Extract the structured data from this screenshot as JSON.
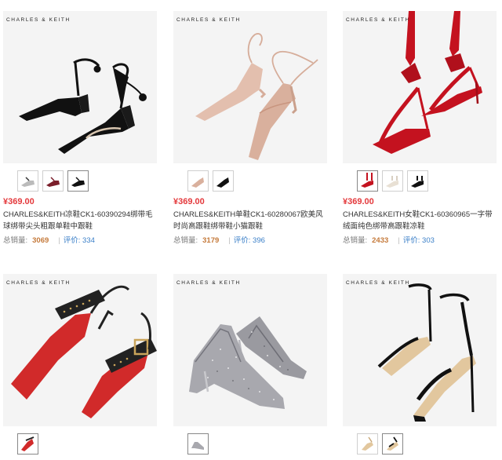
{
  "products": [
    {
      "brand": "CHARLES & KEITH",
      "price": "¥369.00",
      "title": "CHARLES&KEITH凉鞋CK1-60390294绑带毛球绑带尖头粗跟单鞋中跟鞋",
      "sales_label": "总销量:",
      "sales": "3069",
      "reviews_label": "评价:",
      "reviews": "334",
      "image_icon": "black-lace-up-pom-pom-pump-icon",
      "thumbs": [
        "white-variant",
        "burgundy-variant",
        "black-variant"
      ]
    },
    {
      "brand": "CHARLES & KEITH",
      "price": "¥369.00",
      "title": "CHARLES&KEITH单鞋CK1-60280067欧美风时尚高跟鞋绑带鞋小猫跟鞋",
      "sales_label": "总销量:",
      "sales": "3179",
      "reviews_label": "评价:",
      "reviews": "396",
      "image_icon": "nude-lace-up-kitten-heel-icon",
      "thumbs": [
        "nude-variant",
        "black-variant"
      ]
    },
    {
      "brand": "CHARLES & KEITH",
      "price": "¥369.00",
      "title": "CHARLES&KEITH女鞋CK1-60360965一字带绒面纯色绑带高跟鞋凉鞋",
      "sales_label": "总销量:",
      "sales": "2433",
      "reviews_label": "评价:",
      "reviews": "303",
      "image_icon": "red-ribbon-heel-sandal-icon",
      "thumbs": [
        "red-variant",
        "white-variant",
        "black-variant"
      ]
    },
    {
      "brand": "CHARLES & KEITH",
      "image_icon": "red-studded-buckle-slingback-icon",
      "thumbs": [
        "red-variant"
      ]
    },
    {
      "brand": "CHARLES & KEITH",
      "image_icon": "silver-glitter-pump-icon",
      "thumbs": [
        "silver-variant"
      ]
    },
    {
      "brand": "CHARLES & KEITH",
      "image_icon": "black-ankle-strap-sandal-icon",
      "thumbs": [
        "nude-variant",
        "black-variant"
      ]
    }
  ],
  "colors": {
    "price": "#e4393c",
    "sales": "#c57a3b",
    "reviews": "#3a7fc8",
    "image_bg": "#f4f4f4"
  }
}
